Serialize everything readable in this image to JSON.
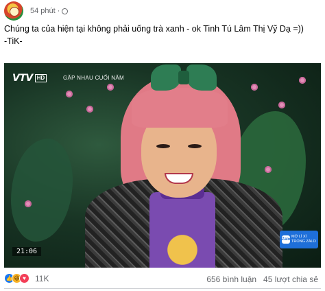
{
  "post": {
    "time": "54 phút",
    "privacy_icon": "globe-icon",
    "text_line1": "Chúng ta của hiện tại không phải uống trà xanh - ok Tinh Tú Lâm Thị Vỹ Dạ =))",
    "text_line2": "-TiK-"
  },
  "video": {
    "channel": "VTV",
    "quality": "HD",
    "show_title": "GẶP NHAU CUỐI NĂM",
    "timestamp": "21:06",
    "zalo_badge_line1": "MỞ LÌ XÌ",
    "zalo_badge_line2": "TRONG ZALO",
    "zalo_logo": "Zalo"
  },
  "footer": {
    "reactions": [
      "like-icon",
      "haha-icon",
      "love-icon"
    ],
    "reaction_count": "11K",
    "comments": "656 bình luận",
    "shares": "45 lượt chia sẻ"
  },
  "colors": {
    "meta_text": "#65676b",
    "like": "#1877f2",
    "love": "#f33e58",
    "haha": "#f7b125"
  }
}
